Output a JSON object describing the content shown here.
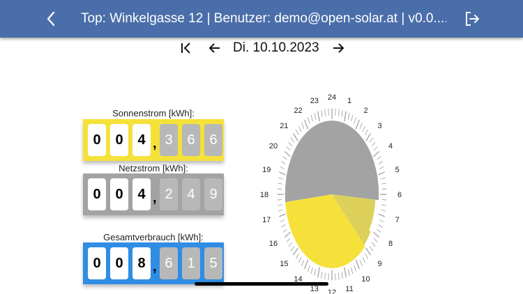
{
  "header": {
    "title": "Top: Winkelgasse 12 | Benutzer: demo@open-solar.at | v0.0...."
  },
  "date_nav": {
    "date": "Di. 10.10.2023"
  },
  "meters": [
    {
      "label": "Sonnenstrom [kWh]:",
      "integer": [
        "0",
        "0",
        "4"
      ],
      "separator": ",",
      "decimals": [
        "3",
        "6",
        "6"
      ],
      "color": "#f5e13a"
    },
    {
      "label": "Netzstrom [kWh]:",
      "integer": [
        "0",
        "0",
        "4"
      ],
      "separator": ",",
      "decimals": [
        "2",
        "4",
        "9"
      ],
      "color": "#a3a3a3"
    },
    {
      "label": "Gesamtverbrauch [kWh]:",
      "integer": [
        "0",
        "0",
        "8"
      ],
      "separator": ",",
      "decimals": [
        "6",
        "1",
        "5"
      ],
      "color": "#2f8de4"
    }
  ],
  "clock": {
    "hour_labels": [
      "1",
      "2",
      "3",
      "4",
      "5",
      "6",
      "7",
      "8",
      "9",
      "10",
      "11",
      "12",
      "13",
      "14",
      "15",
      "16",
      "17",
      "18",
      "19",
      "20",
      "21",
      "22",
      "23",
      "24"
    ],
    "colors": {
      "grid": "#a3a3a3",
      "solar": "#f5e13a",
      "solar_light": "#ddd05a"
    }
  }
}
